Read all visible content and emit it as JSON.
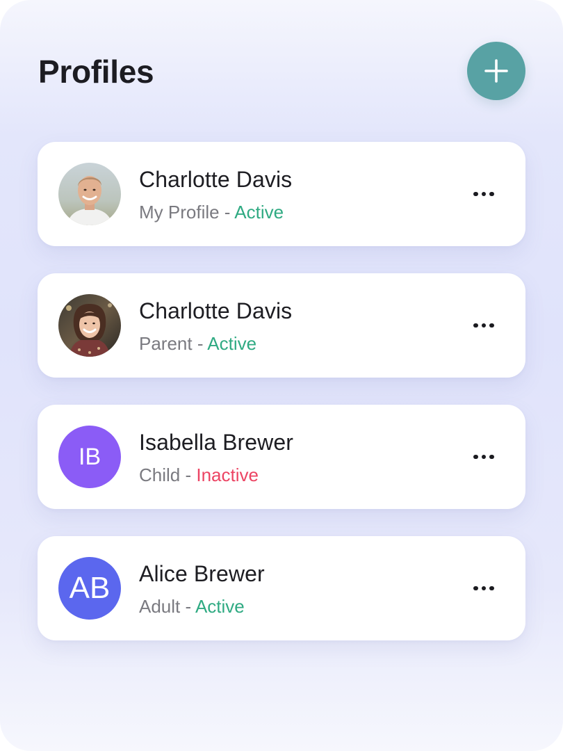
{
  "header": {
    "title": "Profiles",
    "add_icon": "plus-icon"
  },
  "colors": {
    "accent": "#58a2a4",
    "active": "#2faa82",
    "inactive": "#ec4463",
    "avatar_ib": "#8b5cf6",
    "avatar_ab": "#5b67ee"
  },
  "profiles": [
    {
      "name": "Charlotte Davis",
      "role": "My Profile",
      "separator": " - ",
      "status": "Active",
      "avatar_type": "photo",
      "avatar_desc": "avatar-photo-man"
    },
    {
      "name": "Charlotte Davis",
      "role": "Parent",
      "separator": " - ",
      "status": "Active",
      "avatar_type": "photo",
      "avatar_desc": "avatar-photo-woman"
    },
    {
      "name": "Isabella Brewer",
      "role": "Child",
      "separator": " - ",
      "status": "Inactive",
      "avatar_type": "initials",
      "initials": "IB"
    },
    {
      "name": "Alice Brewer",
      "role": "Adult",
      "separator": " - ",
      "status": "Active",
      "avatar_type": "initials",
      "initials": "AB"
    }
  ],
  "more_icon": "more-horizontal-icon"
}
